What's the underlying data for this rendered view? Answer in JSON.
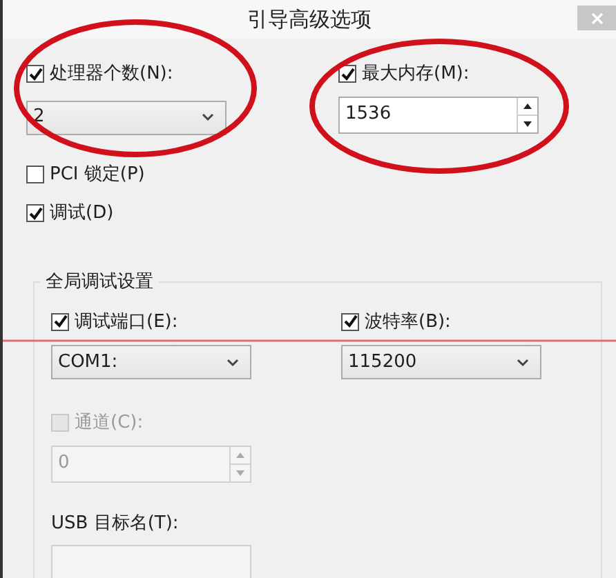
{
  "window": {
    "title": "引导高级选项"
  },
  "processor_count": {
    "label": "处理器个数(N):",
    "checked": true,
    "value": "2"
  },
  "max_memory": {
    "label": "最大内存(M):",
    "checked": true,
    "value": "1536"
  },
  "pci_lock": {
    "label": "PCI 锁定(P)",
    "checked": false
  },
  "debug": {
    "label": "调试(D)",
    "checked": true
  },
  "global_debug_settings": {
    "title": "全局调试设置",
    "debug_port": {
      "label": "调试端口(E):",
      "checked": true,
      "value": "COM1:"
    },
    "baud_rate": {
      "label": "波特率(B):",
      "checked": true,
      "value": "115200"
    },
    "channel": {
      "label": "通道(C):",
      "checked": false,
      "disabled": true,
      "value": "0"
    },
    "usb_target": {
      "label": "USB 目标名(T):"
    }
  }
}
